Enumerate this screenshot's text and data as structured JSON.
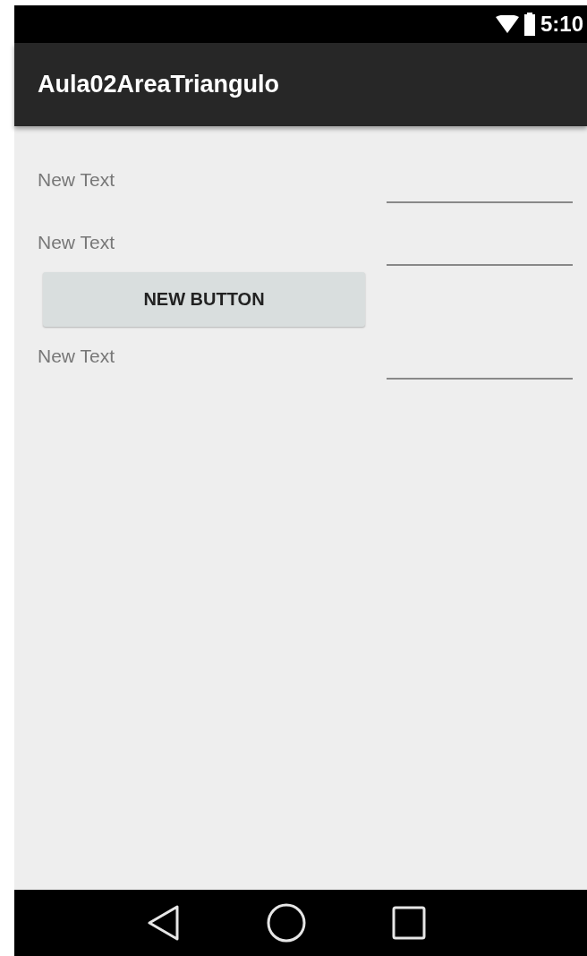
{
  "status_bar": {
    "time": "5:10"
  },
  "app_bar": {
    "title": "Aula02AreaTriangulo"
  },
  "rows": [
    {
      "kind": "field",
      "label": "New Text"
    },
    {
      "kind": "field",
      "label": "New Text"
    },
    {
      "kind": "button",
      "label": "NEW BUTTON"
    },
    {
      "kind": "field",
      "label": "New Text"
    }
  ]
}
